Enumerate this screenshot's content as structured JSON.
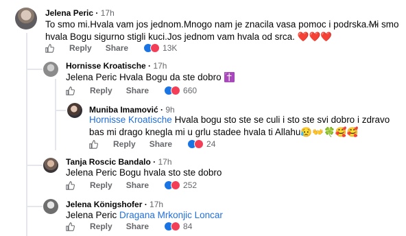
{
  "comments": [
    {
      "author": "Jelena Peric",
      "time": "17h",
      "lines": [
        "To smo mi.Hvala vam jos jednom.Mnogo nam je znacila vasa pomoc i podrska.Mi smo",
        "hvala Bogu sigurno stigli kuci.Jos jednom vam hvala od srca. ❤️❤️❤️"
      ],
      "reply_label": "Reply",
      "share_label": "Share",
      "reaction_count": "13K"
    },
    {
      "author": "Hornisse Kroatische",
      "time": "17h",
      "mention": "Jelena Peric",
      "text": " Hvala Bogu da ste dobro ✝️",
      "reply_label": "Reply",
      "share_label": "Share",
      "reaction_count": "660"
    },
    {
      "author": "Muniba Imamović",
      "time": "9h",
      "mention": "Hornisse Kroatische",
      "text": " Hvala bogu sto ste se culi i sto ste svi dobro i zdravo",
      "line2": "bas mi drago knegla mi u grlu stadee hvala ti Allahu😥👐🍀🥰🥰",
      "reply_label": "Reply",
      "share_label": "Share",
      "reaction_count": "24"
    },
    {
      "author": "Tanja Roscic Bandalo",
      "time": "17h",
      "text": "Jelena Peric Bogu hvala sto ste dobro",
      "reply_label": "Reply",
      "share_label": "Share",
      "reaction_count": "252"
    },
    {
      "author": "Jelena Königshofer",
      "time": "17h",
      "text_prefix": "Jelena Peric ",
      "mention": "Dragana Mrkonjic Loncar",
      "reply_label": "Reply",
      "share_label": "Share",
      "reaction_count": "84"
    }
  ],
  "icons": {
    "like": "thumbs-up-icon",
    "more": "more-options-icon",
    "reaction_like": "like-reaction-icon",
    "reaction_love": "love-reaction-icon"
  },
  "colors": {
    "link": "#216fdb",
    "meta": "#65676b",
    "like": "#1b74e4",
    "love": "#f33e58"
  }
}
